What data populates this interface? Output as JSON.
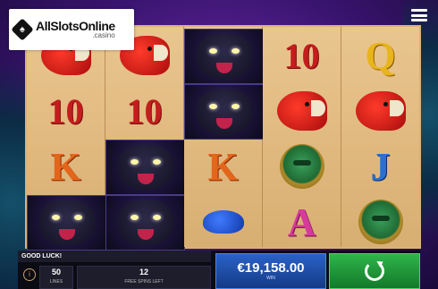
{
  "logo": {
    "badge_glyph": "♠",
    "text": "AllSlotsOnline",
    "sub": ".casino"
  },
  "reels": [
    [
      "parrot",
      "10",
      "K",
      "panther"
    ],
    [
      "parrot",
      "10",
      "panther",
      "panther"
    ],
    [
      "panther",
      "panther",
      "K",
      "frog"
    ],
    [
      "10",
      "parrot",
      "mask",
      "A"
    ],
    [
      "Q",
      "parrot",
      "J",
      "mask"
    ]
  ],
  "status": {
    "message": "GOOD LUCK!"
  },
  "lines": {
    "value": "50",
    "label": "LINES"
  },
  "free_spins": {
    "value": "12",
    "label": "FREE SPINS LEFT"
  },
  "win": {
    "value": "€19,158.00",
    "label": "WIN"
  },
  "colors": {
    "win_panel": "#2a62c8",
    "spin_button": "#2fb44a",
    "reel_bg": "#e9c68f"
  },
  "icons": {
    "menu": "hamburger-icon",
    "info": "info-icon",
    "spin": "spin-refresh-icon"
  }
}
